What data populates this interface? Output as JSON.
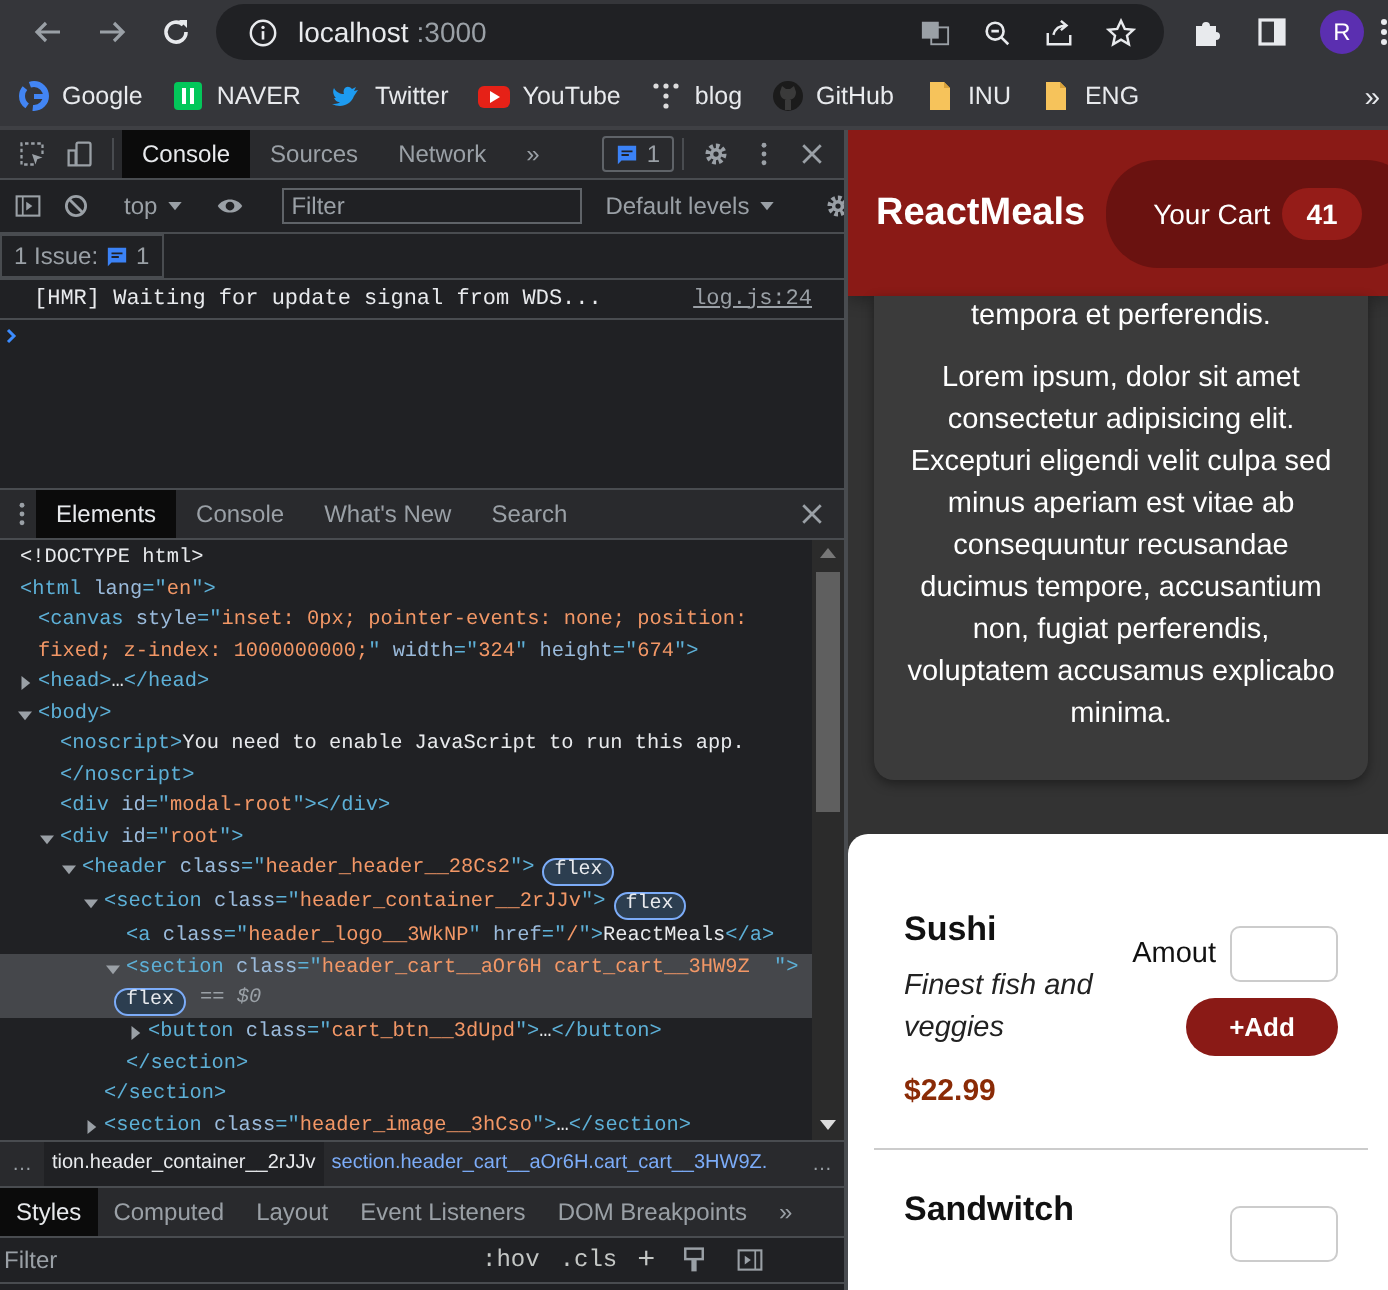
{
  "browser": {
    "url_host": "localhost",
    "url_port": ":3000",
    "profile_initial": "R"
  },
  "bookmarks": [
    {
      "label": "Google",
      "kind": "google"
    },
    {
      "label": "NAVER",
      "kind": "naver"
    },
    {
      "label": "Twitter",
      "kind": "twitter"
    },
    {
      "label": "YouTube",
      "kind": "youtube"
    },
    {
      "label": "blog",
      "kind": "dots"
    },
    {
      "label": "GitHub",
      "kind": "github"
    },
    {
      "label": "INU",
      "kind": "folder"
    },
    {
      "label": "ENG",
      "kind": "folder"
    }
  ],
  "bookmarks_overflow": "»",
  "devtools": {
    "tabs": [
      {
        "label": "Console",
        "selected": true
      },
      {
        "label": "Sources",
        "selected": false
      },
      {
        "label": "Network",
        "selected": false
      }
    ],
    "tabs_overflow": "»",
    "issues_badge": "1",
    "context": "top",
    "filter_placeholder": "Filter",
    "levels": "Default levels",
    "issues_label": "1 Issue:",
    "issues_count": "1",
    "messages": [
      {
        "text": "[HMR] Waiting for update signal from WDS...",
        "source": "log.js:24"
      }
    ]
  },
  "drawer": {
    "tabs": [
      {
        "label": "Elements",
        "selected": true
      },
      {
        "label": "Console",
        "selected": false
      },
      {
        "label": "What's New",
        "selected": false
      },
      {
        "label": "Search",
        "selected": false
      }
    ],
    "tree": [
      {
        "selected": false,
        "parts": [
          {
            "kind": "text",
            "text": "<!DOCTYPE html>"
          }
        ]
      },
      {
        "selected": false,
        "parts": [
          {
            "kind": "tag",
            "text": "<html "
          },
          {
            "kind": "attr",
            "text": "lang"
          },
          {
            "kind": "tag",
            "text": "=\""
          },
          {
            "kind": "value",
            "text": "en"
          },
          {
            "kind": "tag",
            "text": "\">"
          }
        ],
        "children": [
          {
            "selected": false,
            "parts": [
              {
                "kind": "tag",
                "text": "<canvas "
              },
              {
                "kind": "attr",
                "text": "style"
              },
              {
                "kind": "tag",
                "text": "=\""
              },
              {
                "kind": "value",
                "text": "inset: 0px; pointer-events: none; position: fixed; z-index: 1000000000;"
              },
              {
                "kind": "tag",
                "text": "\" "
              },
              {
                "kind": "attr",
                "text": "width"
              },
              {
                "kind": "tag",
                "text": "=\""
              },
              {
                "kind": "value",
                "text": "324"
              },
              {
                "kind": "tag",
                "text": "\" "
              },
              {
                "kind": "attr",
                "text": "height"
              },
              {
                "kind": "tag",
                "text": "=\""
              },
              {
                "kind": "value",
                "text": "674"
              },
              {
                "kind": "tag",
                "text": "\">"
              }
            ]
          },
          {
            "selected": false,
            "expanded": false,
            "parts": [
              {
                "kind": "tag",
                "text": "<head>"
              },
              {
                "kind": "text",
                "text": "…"
              },
              {
                "kind": "tag",
                "text": "</head>"
              }
            ]
          },
          {
            "selected": false,
            "expanded": true,
            "parts": [
              {
                "kind": "tag",
                "text": "<body>"
              }
            ],
            "children": [
              {
                "selected": false,
                "parts": [
                  {
                    "kind": "tag",
                    "text": "<noscript>"
                  },
                  {
                    "kind": "text",
                    "text": "You need to enable JavaScript to run this app."
                  }
                ],
                "closing": "</noscript>"
              },
              {
                "selected": false,
                "parts": [
                  {
                    "kind": "tag",
                    "text": "<div "
                  },
                  {
                    "kind": "attr",
                    "text": "id"
                  },
                  {
                    "kind": "tag",
                    "text": "=\""
                  },
                  {
                    "kind": "value",
                    "text": "modal-root"
                  },
                  {
                    "kind": "tag",
                    "text": "\"></div>"
                  }
                ]
              },
              {
                "selected": false,
                "expanded": true,
                "parts": [
                  {
                    "kind": "tag",
                    "text": "<div "
                  },
                  {
                    "kind": "attr",
                    "text": "id"
                  },
                  {
                    "kind": "tag",
                    "text": "=\""
                  },
                  {
                    "kind": "value",
                    "text": "root"
                  },
                  {
                    "kind": "tag",
                    "text": "\">"
                  }
                ],
                "children": [
                  {
                    "selected": false,
                    "expanded": true,
                    "badge": "flex",
                    "parts": [
                      {
                        "kind": "tag",
                        "text": "<header "
                      },
                      {
                        "kind": "attr",
                        "text": "class"
                      },
                      {
                        "kind": "tag",
                        "text": "=\""
                      },
                      {
                        "kind": "value",
                        "text": "header_header__28Cs2"
                      },
                      {
                        "kind": "tag",
                        "text": "\">"
                      }
                    ],
                    "children": [
                      {
                        "selected": false,
                        "expanded": true,
                        "badge": "flex",
                        "parts": [
                          {
                            "kind": "tag",
                            "text": "<section "
                          },
                          {
                            "kind": "attr",
                            "text": "class"
                          },
                          {
                            "kind": "tag",
                            "text": "=\""
                          },
                          {
                            "kind": "value",
                            "text": "header_container__2rJJv"
                          },
                          {
                            "kind": "tag",
                            "text": "\">"
                          }
                        ],
                        "children": [
                          {
                            "selected": false,
                            "parts": [
                              {
                                "kind": "tag",
                                "text": "<a "
                              },
                              {
                                "kind": "attr",
                                "text": "class"
                              },
                              {
                                "kind": "tag",
                                "text": "=\""
                              },
                              {
                                "kind": "value",
                                "text": "header_logo__3WkNP"
                              },
                              {
                                "kind": "tag",
                                "text": "\" "
                              },
                              {
                                "kind": "attr",
                                "text": "href"
                              },
                              {
                                "kind": "tag",
                                "text": "=\""
                              },
                              {
                                "kind": "value",
                                "text": "/"
                              },
                              {
                                "kind": "tag",
                                "text": "\">"
                              },
                              {
                                "kind": "text",
                                "text": "ReactMeals"
                              },
                              {
                                "kind": "tag",
                                "text": "</a>"
                              }
                            ]
                          },
                          {
                            "selected": true,
                            "expanded": true,
                            "badge": "flex",
                            "suffix": "== $0",
                            "parts": [
                              {
                                "kind": "tag",
                                "text": "<section "
                              },
                              {
                                "kind": "attr",
                                "text": "class"
                              },
                              {
                                "kind": "tag",
                                "text": "=\""
                              },
                              {
                                "kind": "value",
                                "text": "header_cart__aOr6H cart_cart__3HW9Z  "
                              },
                              {
                                "kind": "tag",
                                "text": "\">"
                              }
                            ],
                            "children": [
                              {
                                "selected": false,
                                "expanded": false,
                                "parts": [
                                  {
                                    "kind": "tag",
                                    "text": "<button "
                                  },
                                  {
                                    "kind": "attr",
                                    "text": "class"
                                  },
                                  {
                                    "kind": "tag",
                                    "text": "=\""
                                  },
                                  {
                                    "kind": "value",
                                    "text": "cart_btn__3dUpd"
                                  },
                                  {
                                    "kind": "tag",
                                    "text": "\">"
                                  },
                                  {
                                    "kind": "text",
                                    "text": "…"
                                  },
                                  {
                                    "kind": "tag",
                                    "text": "</button>"
                                  }
                                ]
                              }
                            ],
                            "closing": "</section>"
                          }
                        ],
                        "closing": "</section>"
                      },
                      {
                        "selected": false,
                        "expanded": false,
                        "parts": [
                          {
                            "kind": "tag",
                            "text": "<section "
                          },
                          {
                            "kind": "attr",
                            "text": "class"
                          },
                          {
                            "kind": "tag",
                            "text": "=\""
                          },
                          {
                            "kind": "value",
                            "text": "header_image__3hCso"
                          },
                          {
                            "kind": "tag",
                            "text": "\">"
                          },
                          {
                            "kind": "text",
                            "text": "…"
                          },
                          {
                            "kind": "tag",
                            "text": "</section>"
                          }
                        ]
                      }
                    ]
                  }
                ]
              }
            ]
          }
        ]
      }
    ],
    "breadcrumbs": [
      {
        "label": "tion.header_container__2rJJv",
        "selected": false
      },
      {
        "label": "section.header_cart__aOr6H.cart_cart__3HW9Z.",
        "selected": true
      }
    ],
    "breadcrumb_more": "…",
    "styles_tabs": [
      {
        "label": "Styles",
        "selected": true
      },
      {
        "label": "Computed",
        "selected": false
      },
      {
        "label": "Layout",
        "selected": false
      },
      {
        "label": "Event Listeners",
        "selected": false
      },
      {
        "label": "DOM Breakpoints",
        "selected": false
      }
    ],
    "styles_overflow": "»",
    "styles_filter_placeholder": "Filter",
    "hov": ":hov",
    "cls": ".cls",
    "plus": "+"
  },
  "page": {
    "logo": "ReactMeals",
    "cart_label": "Your Cart",
    "cart_count": "41",
    "summary": [
      "tempora et perferendis.",
      "Lorem ipsum, dolor sit amet consectetur adipisicing elit. Excepturi eligendi velit culpa sed minus aperiam est vitae ab consequuntur recusandae ducimus tempore, accusantium non, fugiat perferendis, voluptatem accusamus explicabo minima."
    ],
    "meals": [
      {
        "name": "Sushi",
        "description": "Finest fish and veggies",
        "price": "$22.99",
        "amount_label": "Amout",
        "add_label": "+Add"
      },
      {
        "name": "Sandwitch"
      }
    ]
  }
}
